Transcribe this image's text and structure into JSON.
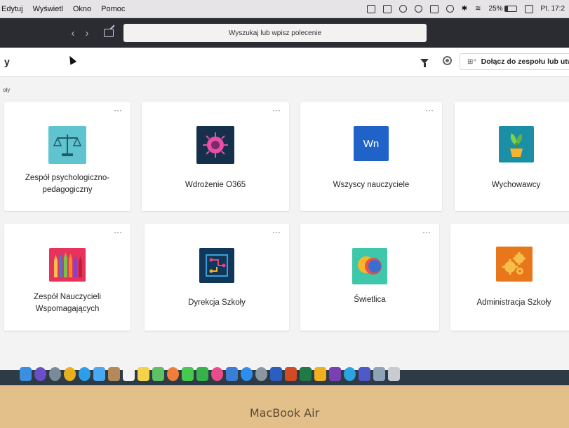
{
  "menubar": {
    "items": [
      "Edytuj",
      "Wyświetl",
      "Okno",
      "Pomoc"
    ],
    "battery_percent": "25%",
    "clock": "Pt. 17:2"
  },
  "titlebar": {
    "search_placeholder": "Wyszukaj lub wpisz polecenie"
  },
  "topbar": {
    "title": "y",
    "join_button_label": "Dołącz do zespołu lub utwó",
    "section_label": "oły"
  },
  "teams": [
    {
      "name": "Zespół psychologiczno-pedagogiczny",
      "icon": "scales-icon",
      "color": "#5fc4cf"
    },
    {
      "name": "Wdrożenie O365",
      "icon": "virus-icon",
      "color": "#14304a"
    },
    {
      "name": "Wszyscy nauczyciele",
      "icon": "initials-icon",
      "initials": "Wn",
      "color": "#1f63c9"
    },
    {
      "name": "Wychowawcy",
      "icon": "plant-icon",
      "color": "#1b8fa6"
    },
    {
      "name": "Zespół Nauczycieli Wspomagających",
      "icon": "crayons-icon",
      "color": "#e8325d"
    },
    {
      "name": "Dyrekcja Szkoły",
      "icon": "circuit-icon",
      "color": "#10365a"
    },
    {
      "name": "Świetlica",
      "icon": "speech-bubbles-icon",
      "color": "#3ec7a8"
    },
    {
      "name": "Administracja Szkoły",
      "icon": "gears-icon",
      "color": "#e8771c"
    }
  ],
  "laptop": {
    "brand": "MacBook Air"
  }
}
